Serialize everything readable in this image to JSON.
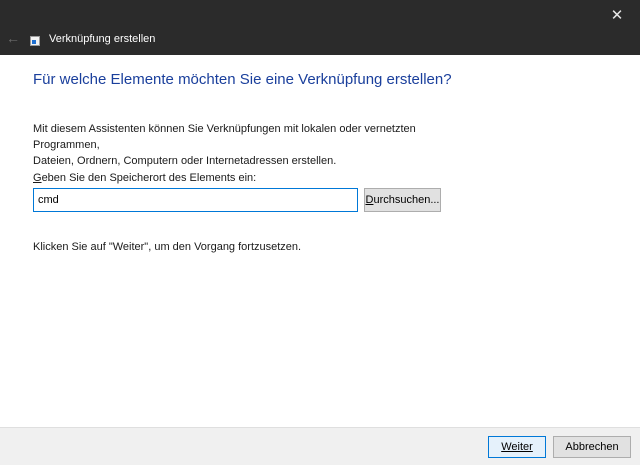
{
  "window": {
    "title": "Verknüpfung erstellen",
    "close_glyph": "✕",
    "back_glyph": "←"
  },
  "main": {
    "heading": "Für welche Elemente möchten Sie eine Verknüpfung erstellen?",
    "description_line1": "Mit diesem Assistenten können Sie Verknüpfungen mit lokalen oder vernetzten Programmen,",
    "description_line2": "Dateien, Ordnern, Computern oder Internetadressen erstellen.",
    "location_label_accel": "G",
    "location_label_rest": "eben Sie den Speicherort des Elements ein:",
    "location_value": "cmd",
    "browse_accel": "D",
    "browse_rest": "urchsuchen...",
    "hint": "Klicken Sie auf \"Weiter\", um den Vorgang fortzusetzen."
  },
  "footer": {
    "next_label": "Weiter",
    "cancel_label": "Abbrechen"
  },
  "colors": {
    "titlebar": "#2b2b2b",
    "heading": "#1a3f9c",
    "focus": "#0078d7"
  }
}
